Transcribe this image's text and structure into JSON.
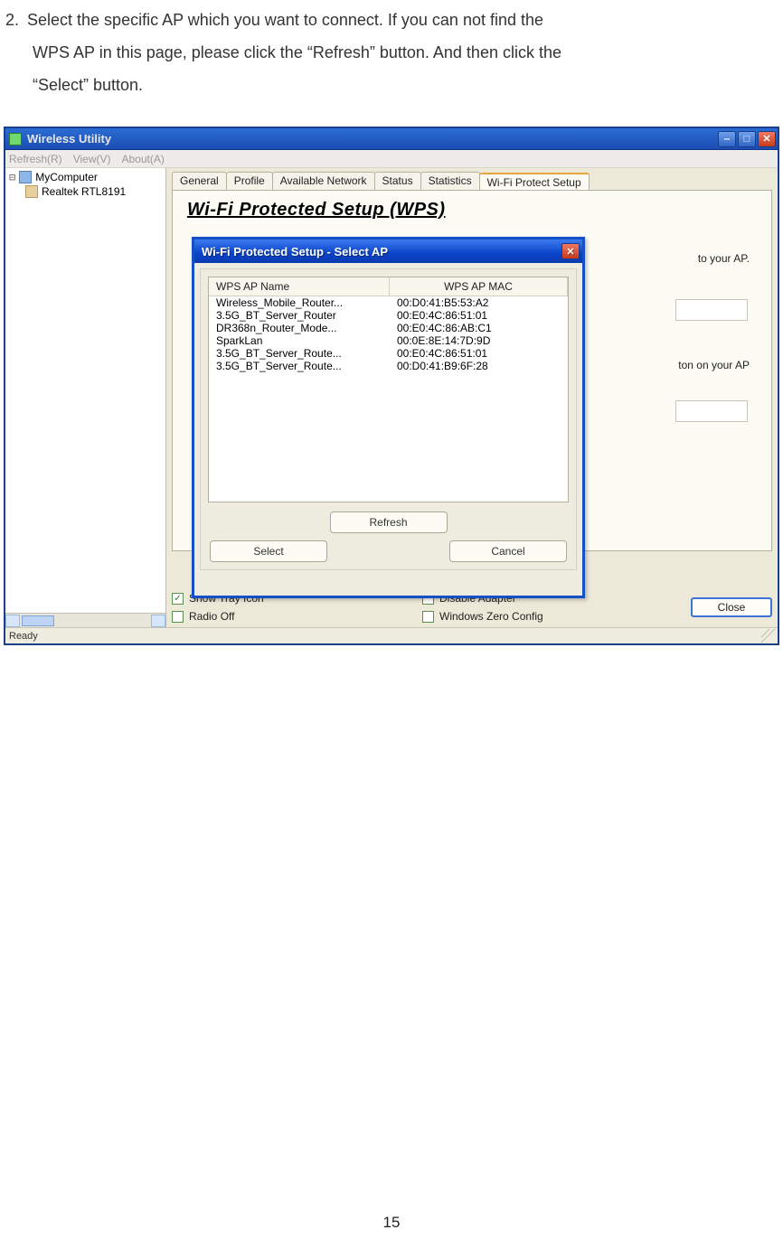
{
  "instruction": {
    "number": "2.",
    "text_line1": "Select the specific AP which you want to connect. If you can not find the",
    "text_line2": "WPS AP in this page, please click the “Refresh” button. And then click the",
    "text_line3": "“Select” button."
  },
  "main_window": {
    "title": "Wireless Utility",
    "menu": {
      "refresh": "Refresh(R)",
      "view": "View(V)",
      "about": "About(A)"
    },
    "tree": {
      "root": "MyComputer",
      "child": "Realtek RTL8191"
    },
    "tabs": {
      "general": "General",
      "profile": "Profile",
      "available": "Available Network",
      "status": "Status",
      "statistics": "Statistics",
      "wps": "Wi-Fi Protect Setup"
    },
    "wps_heading": "Wi-Fi Protected Setup (WPS)",
    "peek_text1": "to your AP.",
    "peek_text2": "ton on your AP",
    "options": {
      "show_tray": "Show Tray Icon",
      "radio_off": "Radio Off",
      "disable_adapter": "Disable Adapter",
      "wzc": "Windows Zero Config"
    },
    "close_label": "Close",
    "status_text": "Ready"
  },
  "modal": {
    "title": "Wi-Fi Protected Setup - Select AP",
    "columns": {
      "name": "WPS AP Name",
      "mac": "WPS AP MAC"
    },
    "rows": [
      {
        "name": "Wireless_Mobile_Router...",
        "mac": "00:D0:41:B5:53:A2"
      },
      {
        "name": "3.5G_BT_Server_Router",
        "mac": "00:E0:4C:86:51:01"
      },
      {
        "name": "DR368n_Router_Mode...",
        "mac": "00:E0:4C:86:AB:C1"
      },
      {
        "name": "SparkLan",
        "mac": "00:0E:8E:14:7D:9D"
      },
      {
        "name": "3.5G_BT_Server_Route...",
        "mac": "00:E0:4C:86:51:01"
      },
      {
        "name": "3.5G_BT_Server_Route...",
        "mac": "00:D0:41:B9:6F:28"
      }
    ],
    "buttons": {
      "refresh": "Refresh",
      "select": "Select",
      "cancel": "Cancel"
    }
  },
  "page_number": "15"
}
